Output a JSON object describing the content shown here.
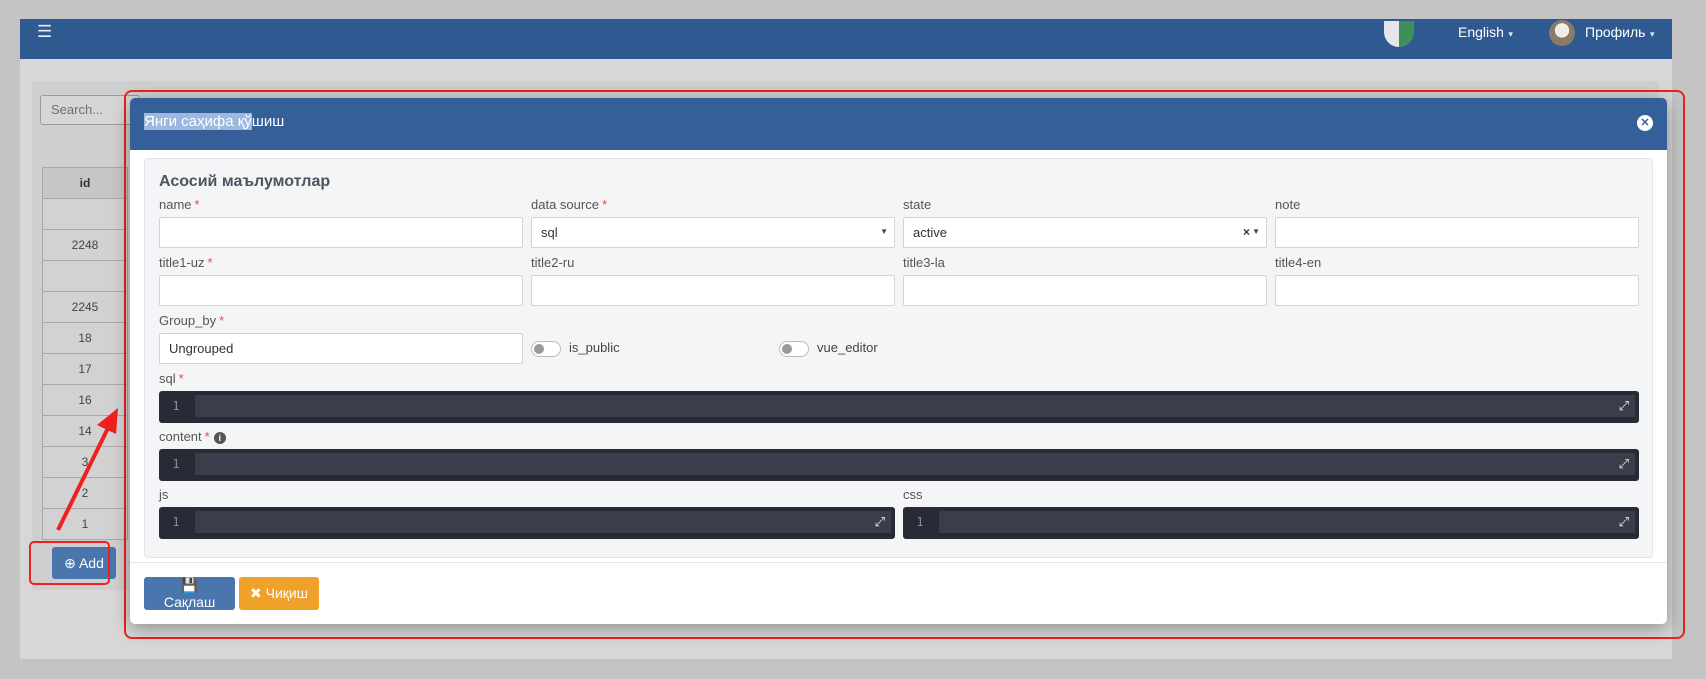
{
  "navbar": {
    "menu_icon": "hamburger-icon",
    "language": "English",
    "profile": "Профиль"
  },
  "background": {
    "search_placeholder": "Search...",
    "table": {
      "header": "id",
      "rows": [
        "",
        "2248",
        "",
        "2245",
        "18",
        "17",
        "16",
        "14",
        "3",
        "2",
        "1"
      ]
    },
    "add_button": "Add"
  },
  "modal": {
    "title_selected": "Янги саҳифа қў",
    "title_rest": "шиш",
    "section": "Асосий маълумотлар",
    "fields": {
      "name": {
        "label": "name",
        "value": ""
      },
      "data_source": {
        "label": "data source",
        "value": "sql"
      },
      "state": {
        "label": "state",
        "value": "active"
      },
      "note": {
        "label": "note",
        "value": ""
      },
      "title1": {
        "label": "title1-uz",
        "value": ""
      },
      "title2": {
        "label": "title2-ru",
        "value": ""
      },
      "title3": {
        "label": "title3-la",
        "value": ""
      },
      "title4": {
        "label": "title4-en",
        "value": ""
      },
      "group_by": {
        "label": "Group_by",
        "value": "Ungrouped"
      },
      "is_public": {
        "label": "is_public",
        "checked": false
      },
      "vue_editor": {
        "label": "vue_editor",
        "checked": false
      },
      "sql": {
        "label": "sql",
        "line": "1"
      },
      "content": {
        "label": "content",
        "line": "1"
      },
      "js": {
        "label": "js",
        "line": "1"
      },
      "css": {
        "label": "css",
        "line": "1"
      }
    },
    "save_button": "Сақлаш",
    "exit_button": "Чиқиш"
  },
  "colors": {
    "primary": "#345f99",
    "navbar": "#2f5a91",
    "save": "#4a76ad",
    "exit": "#f0a12a",
    "highlight": "#ee2020",
    "editor": "#282a36"
  }
}
